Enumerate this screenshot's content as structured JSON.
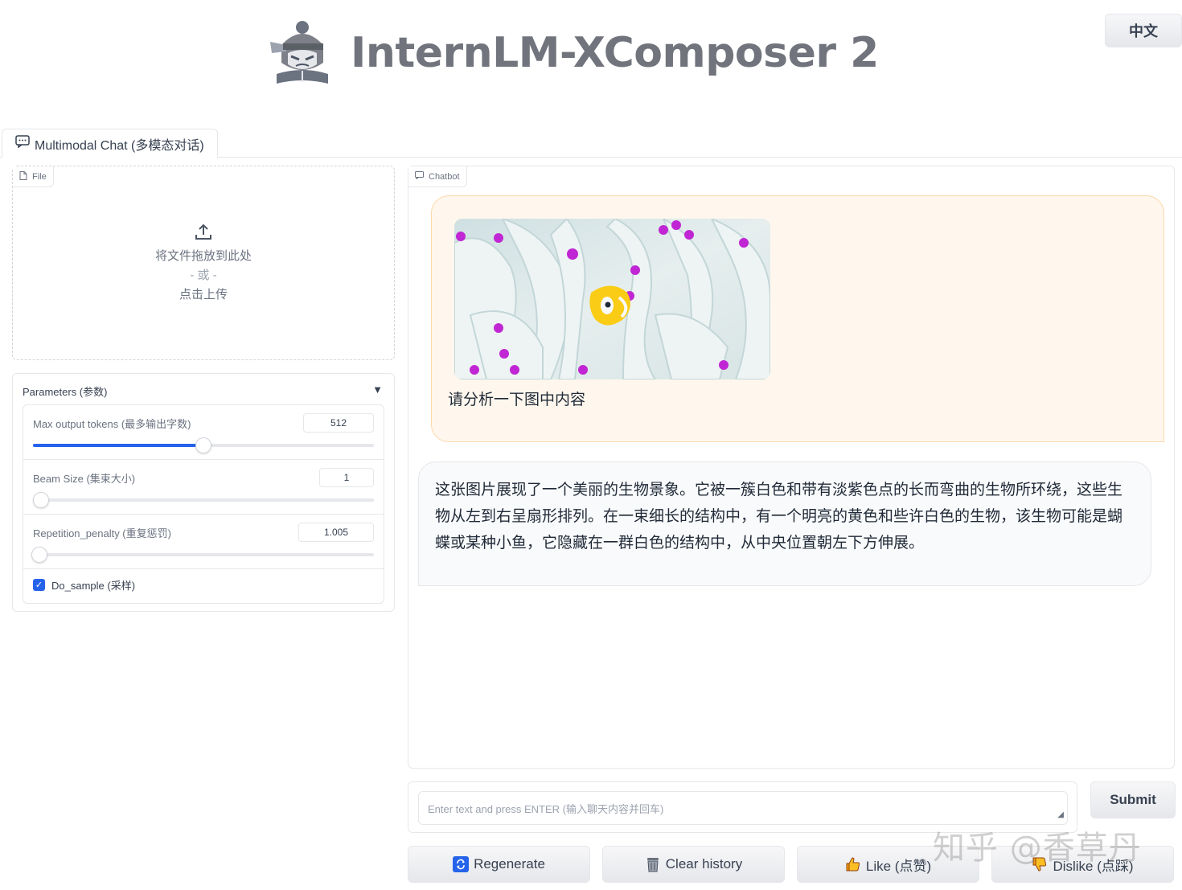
{
  "header": {
    "logo_text": "InternLM-XComposer 2",
    "lang_button": "中文"
  },
  "tabs": [
    {
      "label": "Multimodal Chat (多模态对话)",
      "icon": "chat-icon"
    }
  ],
  "file_block": {
    "label": "File",
    "drop_text": "将文件拖放到此处",
    "or_text": "- 或 -",
    "click_text": "点击上传"
  },
  "parameters": {
    "title": "Parameters (参数)",
    "max_tokens": {
      "label": "Max output tokens (最多输出字数)",
      "value": "512",
      "fraction": 0.5
    },
    "beam_size": {
      "label": "Beam Size (集束大小)",
      "value": "1",
      "fraction": 0.0
    },
    "repetition_penalty": {
      "label": "Repetition_penalty (重复惩罚)",
      "value": "1.005",
      "fraction": 0.02
    },
    "do_sample": {
      "label": "Do_sample (采样)",
      "checked": true
    }
  },
  "chatbot": {
    "label": "Chatbot",
    "user_message": "请分析一下图中内容",
    "bot_message": "这张图片展现了一个美丽的生物景象。它被一簇白色和带有淡紫色点的长而弯曲的生物所环绕，这些生物从左到右呈扇形排列。在一束细长的结构中，有一个明亮的黄色和些许白色的生物，该生物可能是蝴蝶或某种小鱼，它隐藏在一群白色的结构中，从中央位置朝左下方伸展。"
  },
  "input": {
    "placeholder": "Enter text and press ENTER (输入聊天内容并回车)",
    "submit_label": "Submit"
  },
  "actions": {
    "regenerate": "Regenerate",
    "clear_history": "Clear history",
    "like": "Like (点赞)",
    "dislike": "Dislike (点踩)"
  },
  "watermark": "知乎 @香草丹",
  "colors": {
    "accent": "#2563eb",
    "user_bubble": "#fff7ed",
    "bot_bubble": "#f9fafb"
  }
}
